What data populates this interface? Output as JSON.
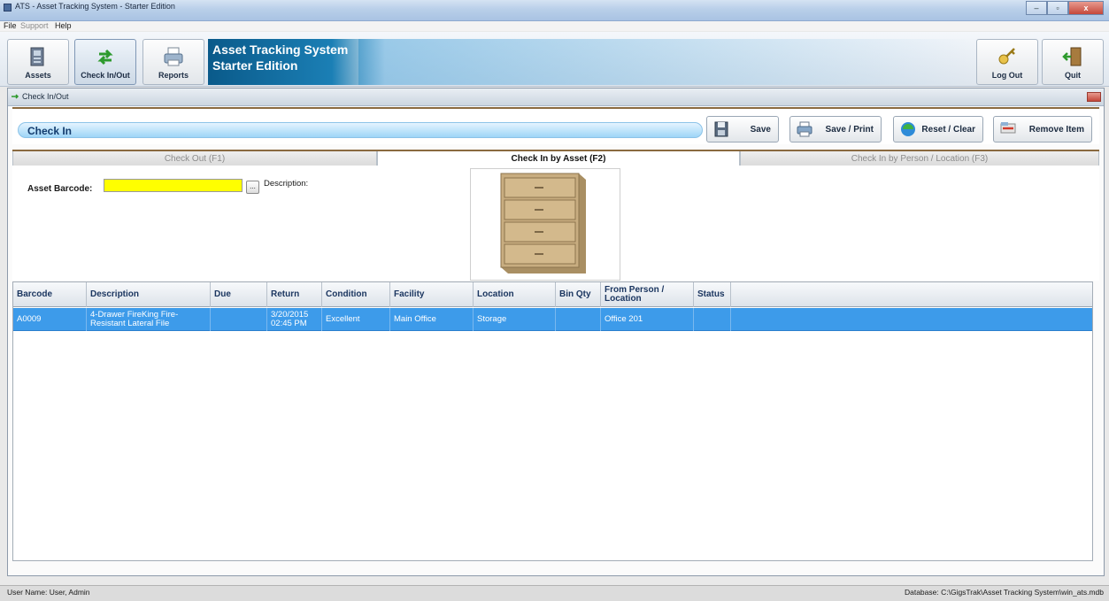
{
  "window": {
    "title": "ATS - Asset Tracking System - Starter Edition",
    "min": "–",
    "max": "▫",
    "close": "x"
  },
  "menu": {
    "file": "File",
    "support": "Support",
    "help": "Help"
  },
  "toolbar": {
    "assets": "Assets",
    "checkinout": "Check In/Out",
    "reports": "Reports",
    "logout": "Log Out",
    "quit": "Quit"
  },
  "banner": {
    "line1": "Asset Tracking System",
    "line2": "Starter Edition"
  },
  "doc": {
    "title": "Check In/Out"
  },
  "header": {
    "title": "Check In"
  },
  "actions": {
    "save": "Save",
    "save_print": "Save / Print",
    "reset_clear": "Reset / Clear",
    "remove_item": "Remove Item"
  },
  "tabs": {
    "checkout": "Check Out (F1)",
    "checkin_asset": "Check In by Asset (F2)",
    "checkin_person": "Check In by Person / Location (F3)"
  },
  "form": {
    "barcode_label": "Asset Barcode:",
    "barcode_value": "",
    "browse": "...",
    "description_label": "Description:"
  },
  "grid": {
    "columns": [
      "Barcode",
      "Description",
      "Due",
      "Return",
      "Condition",
      "Facility",
      "Location",
      "Bin Qty",
      "From Person / Location",
      "Status"
    ],
    "rows": [
      {
        "barcode": "A0009",
        "description": "4-Drawer FireKing Fire-Resistant Lateral File",
        "due": "",
        "return": "3/20/2015 02:45 PM",
        "condition": "Excellent",
        "facility": "Main Office",
        "location": "Storage",
        "bin_qty": "",
        "from": "Office 201",
        "status": ""
      }
    ]
  },
  "status": {
    "user": "User Name:  User, Admin",
    "db": "Database:  C:\\GigsTrak\\Asset Tracking System\\win_ats.mdb"
  },
  "colors": {
    "selected_row": "#3d9bea",
    "barcode_field": "#ffff00",
    "banner": "#1b7fb5"
  }
}
